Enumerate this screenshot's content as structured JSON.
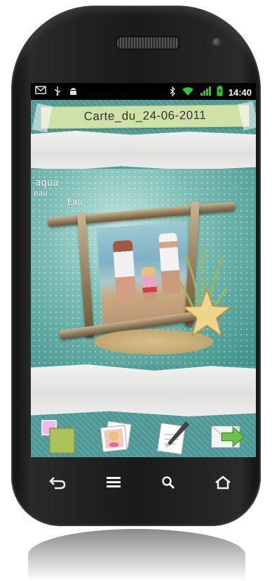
{
  "status_bar": {
    "time": "14:40",
    "left_icons": [
      "mail-icon",
      "usb-icon",
      "android-debug-icon"
    ],
    "right_icons": [
      "bluetooth-icon",
      "wifi-icon",
      "signal-icon",
      "battery-charging-icon"
    ]
  },
  "app": {
    "title": "Carte_du_24-06-2011",
    "photo_text": {
      "line1": "aqua",
      "line2": "eau",
      "line3": "Eau"
    },
    "toolbar": {
      "buttons": [
        {
          "name": "color-picker-button",
          "icon": "color-squares-icon"
        },
        {
          "name": "photo-gallery-button",
          "icon": "photo-stack-icon"
        },
        {
          "name": "write-text-button",
          "icon": "pencil-note-icon"
        },
        {
          "name": "next-button",
          "icon": "arrow-right-icon"
        }
      ]
    },
    "colors": {
      "background_teal": "#5aa3a0",
      "banner_green": "#cfe1a6",
      "swatch_pink": "#f4b8e8",
      "swatch_green": "#a9c25a",
      "arrow_green": "#6cc14a"
    }
  },
  "navigation_bar": {
    "buttons": [
      "back-icon",
      "menu-icon",
      "search-icon",
      "home-icon"
    ]
  }
}
